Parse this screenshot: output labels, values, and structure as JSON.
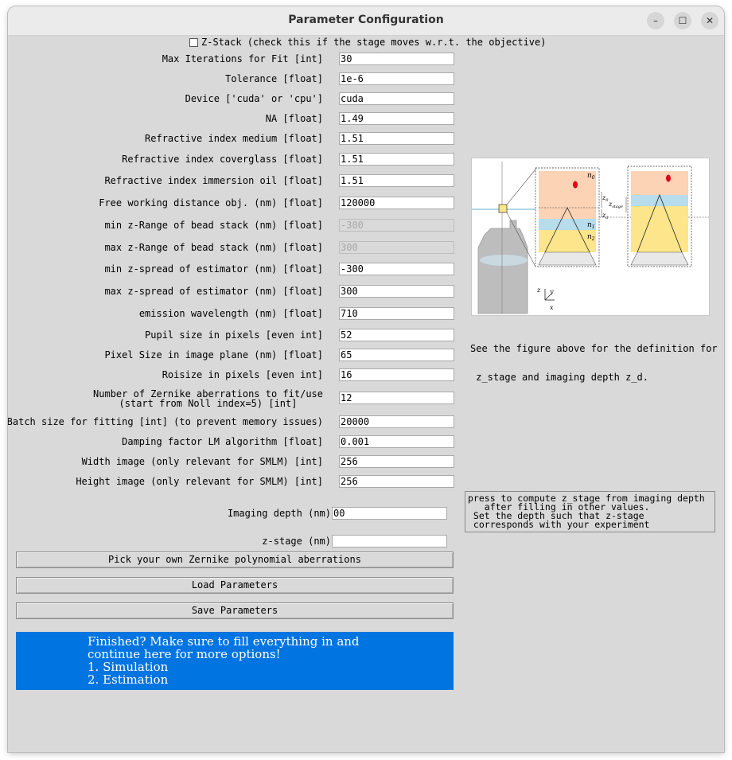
{
  "window": {
    "title": "Parameter Configuration",
    "controls": [
      "–",
      "☐",
      "✕"
    ]
  },
  "zstack": {
    "checked": false,
    "label": "Z-Stack (check this if the stage moves w.r.t. the objective)"
  },
  "fields": [
    {
      "label": "Max Iterations for Fit [int]",
      "value": "30"
    },
    {
      "label": "Tolerance [float]",
      "value": "1e-6"
    },
    {
      "label": "Device ['cuda' or 'cpu']",
      "value": "cuda"
    },
    {
      "label": "NA [float]",
      "value": "1.49"
    },
    {
      "label": "Refractive index medium [float]",
      "value": "1.51"
    },
    {
      "label": "Refractive index coverglass [float]",
      "value": "1.51"
    },
    {
      "label": "Refractive index immersion oil [float]",
      "value": "1.51"
    },
    {
      "label": "Free working distance obj. (nm) [float]",
      "value": "120000"
    },
    {
      "label": "min z-Range of bead stack (nm) [float]",
      "value": "-300"
    },
    {
      "label": "max z-Range of bead stack (nm) [float]",
      "value": "300"
    },
    {
      "label": "min z-spread of estimator (nm) [float]",
      "value": "-300"
    },
    {
      "label": "max z-spread of estimator (nm) [float]",
      "value": "300"
    },
    {
      "label": "emission wavelength (nm) [float]",
      "value": "710"
    },
    {
      "label": "Pupil size in pixels [even int]",
      "value": "52"
    },
    {
      "label": "Pixel Size in image plane (nm) [float]",
      "value": "65"
    },
    {
      "label": "Roisize in pixels [even int]",
      "value": "16"
    },
    {
      "label_line1": "Number of Zernike aberrations to fit/use",
      "label_line2": "(start from Noll index=5) [int]",
      "value": "12"
    },
    {
      "label": "Batch size for fitting [int] (to prevent memory issues)",
      "value": "20000"
    },
    {
      "label": "Damping factor LM algorithm [float]",
      "value": "0.001"
    },
    {
      "label": "Width image (only relevant for SMLM) [int]",
      "value": "256"
    },
    {
      "label": "Height image (only relevant for SMLM) [int]",
      "value": "256"
    }
  ],
  "imaging_depth": {
    "label": "Imaging depth (nm)",
    "value": "00"
  },
  "z_stage": {
    "label": "z-stage (nm)",
    "value": ""
  },
  "buttons": {
    "zernike": "Pick your own Zernike polynomial aberrations",
    "load": "Load Parameters",
    "save": "Save Parameters"
  },
  "figure": {
    "labels": {
      "n0": "n",
      "n0_sub": "0",
      "n1": "n",
      "n1_sub": "1",
      "n2": "n",
      "n2_sub": "2",
      "z0": "z",
      "z0_sub": "0",
      "zd": "z",
      "zd_sub": "d",
      "zstage": "z",
      "zstage_sub": "stage",
      "axis_z": "z",
      "axis_y": "y",
      "axis_x": "x"
    },
    "caption_line1": "See the figure above for the definition for",
    "caption_line2": " z_stage and imaging depth z_d."
  },
  "compute_button": {
    "line1": "press to compute z_stage from imaging depth",
    "line2": "   after filling in other values.",
    "line3": " Set the depth such that z-stage",
    "line4": " corresponds with your experiment"
  },
  "finished": {
    "line1": "Finished? Make sure to fill everything in and",
    "line2": "continue here for more options!",
    "line3": "1. Simulation",
    "line4": "2. Estimation"
  },
  "colors": {
    "finished_bg": "#0074e0",
    "medium": "#fcd3b4",
    "coverglass": "#b7dcec",
    "oil": "#fce58b",
    "bead": "#e0001b"
  }
}
